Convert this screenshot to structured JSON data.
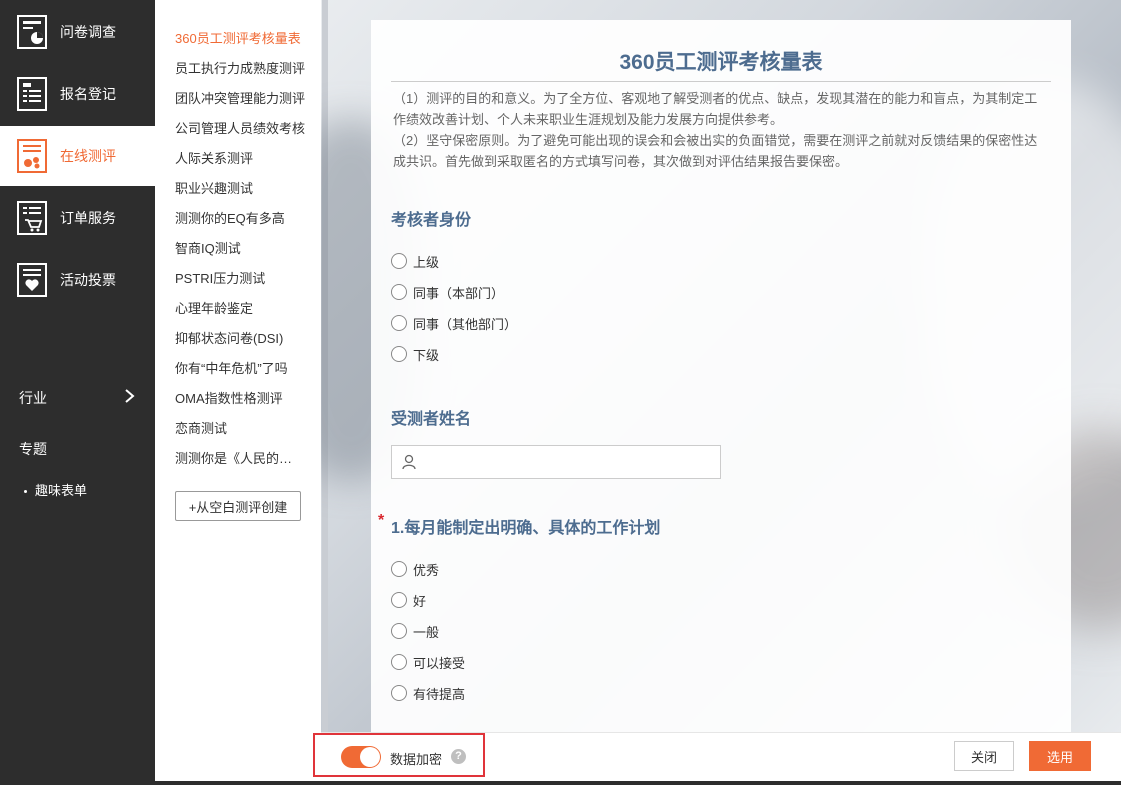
{
  "sidebar": {
    "items": [
      {
        "label": "问卷调查",
        "icon": "survey-icon"
      },
      {
        "label": "报名登记",
        "icon": "registration-icon"
      },
      {
        "label": "在线测评",
        "icon": "assessment-icon",
        "active": true
      },
      {
        "label": "订单服务",
        "icon": "order-icon"
      },
      {
        "label": "活动投票",
        "icon": "vote-icon"
      }
    ],
    "industry_label": "行业",
    "topic_label": "专题",
    "topic_sub_label": "趣味表单"
  },
  "templates": {
    "items": [
      "360员工测评考核量表",
      "员工执行力成熟度测评",
      "团队冲突管理能力测评",
      "公司管理人员绩效考核",
      "人际关系测评",
      "职业兴趣测试",
      "测测你的EQ有多高",
      "智商IQ测试",
      "PSTRI压力测试",
      "心理年龄鉴定",
      "抑郁状态问卷(DSI)",
      "你有“中年危机”了吗",
      "OMA指数性格测评",
      "恋商测试",
      "测测你是《人民的名义》里的谁"
    ],
    "create_label": "+从空白测评创建"
  },
  "form": {
    "title": "360员工测评考核量表",
    "intro_1": "（1）测评的目的和意义。为了全方位、客观地了解受测者的优点、缺点，发现其潜在的能力和盲点，为其制定工作绩效改善计划、个人未来职业生涯规划及能力发展方向提供参考。",
    "intro_2": "（2）坚守保密原则。为了避免可能出现的误会和会被出实的负面错觉，需要在测评之前就对反馈结果的保密性达成共识。首先做到采取匿名的方式填写问卷，其次做到对评估结果报告要保密。",
    "q_identity": {
      "title": "考核者身份",
      "options": [
        "上级",
        "同事（本部门）",
        "同事（其他部门）",
        "下级"
      ]
    },
    "q_name": {
      "title": "受测者姓名",
      "placeholder": ""
    },
    "q1": {
      "required_mark": "*",
      "title": "1.每月能制定出明确、具体的工作计划",
      "options": [
        "优秀",
        "好",
        "一般",
        "可以接受",
        "有待提高"
      ]
    }
  },
  "bottom_bar": {
    "encrypt_label": "数据加密",
    "encrypt_on": true,
    "help_glyph": "?",
    "close_label": "关闭",
    "select_label": "选用"
  },
  "colors": {
    "accent": "#f06a35",
    "sidebar_bg": "#2d2d2d",
    "title_blue": "#4d6c8f",
    "highlight_red": "#e0343a"
  }
}
